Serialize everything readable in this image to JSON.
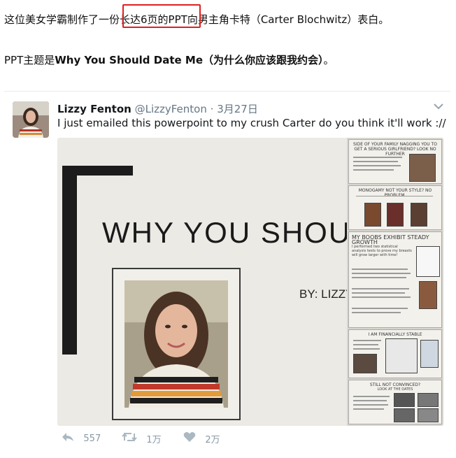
{
  "article": {
    "line1": {
      "before": "这位美女学霸制作了一份",
      "highlight": "长达6页的PPT",
      "after": "向男主角卡特（Carter Blochwitz）表白。"
    },
    "line2": {
      "prefix": "PPT主题是",
      "title": "Why You Should Date Me（为什么你应该跟我约会）",
      "suffix": "。"
    }
  },
  "tweet": {
    "name": "Lizzy Fenton",
    "handle": "@LizzyFenton",
    "dot": "·",
    "date": "3月27日",
    "text": "I just emailed this powerpoint to my crush Carter do you think it'll work ://",
    "chevron_icon": "chevron-down-icon",
    "slide": {
      "title": "WHY YOU SHOULD",
      "byline": "BY: LIZZY F"
    },
    "thumbnails": [
      {
        "title": "SIDE OF YOUR FAMILY NAGGING YOU TO GET A SERIOUS GIRLFRIEND? LOOK NO FURTHER"
      },
      {
        "title": "MONOGAMY NOT YOUR STYLE? NO PROBLEM."
      },
      {
        "title": "MY BOOBS EXHIBIT STEADY GROWTH",
        "body": "I performed two statistical analysis tests to prove my breasts will grow larger with time!"
      },
      {
        "title": "I AM FINANCIALLY STABLE"
      },
      {
        "title": "STILL NOT CONVINCED?",
        "subtitle": "LOOK AT THE DATES"
      }
    ],
    "actions": {
      "reply": {
        "icon": "reply-icon",
        "count": "557"
      },
      "retweet": {
        "icon": "retweet-icon",
        "count": "1万"
      },
      "like": {
        "icon": "heart-icon",
        "count": "2万"
      }
    }
  },
  "colors": {
    "highlight_box": "#e02020",
    "muted": "#657786",
    "icon": "#aab8c2"
  }
}
